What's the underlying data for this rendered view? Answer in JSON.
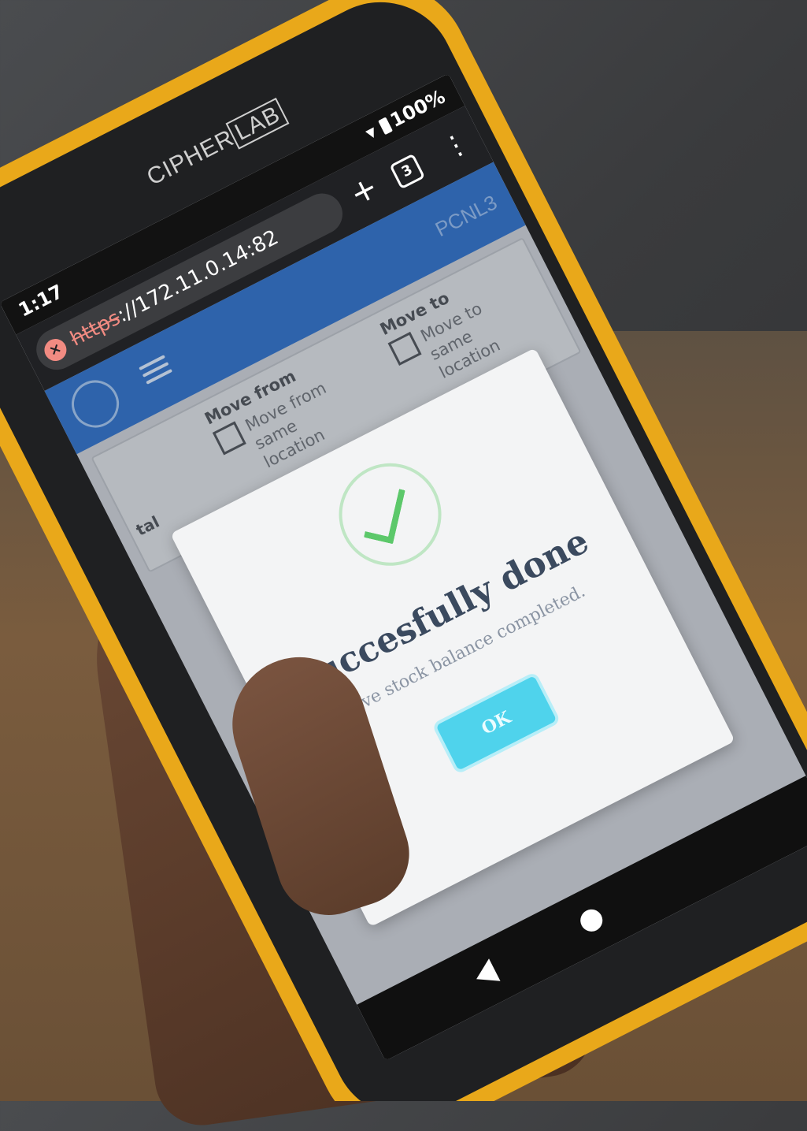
{
  "device": {
    "brand": "CIPHERLAB",
    "brand_left": "CIPHER",
    "brand_right": "LAB"
  },
  "statusbar": {
    "time": "1:17",
    "battery": "100%"
  },
  "browser": {
    "url_scheme": "https",
    "url_rest": "://172.11.0.14:82",
    "tab_count": "3",
    "plus": "+",
    "menu": "⋮",
    "insecure": "×"
  },
  "app": {
    "code": "PCNL3"
  },
  "form": {
    "total_label": "tal",
    "move_from": {
      "heading": "Move from",
      "option": "Move from same location"
    },
    "move_to": {
      "heading": "Move to",
      "option": "Move to same location"
    }
  },
  "dialog": {
    "title": "Succesfully done",
    "message": "Move stock balance completed.",
    "ok_label": "OK"
  },
  "colors": {
    "bumper": "#e9a81a",
    "appbar": "#2b6cc4",
    "ok_button": "#4fd3ec",
    "success_check": "#5cc86a"
  }
}
